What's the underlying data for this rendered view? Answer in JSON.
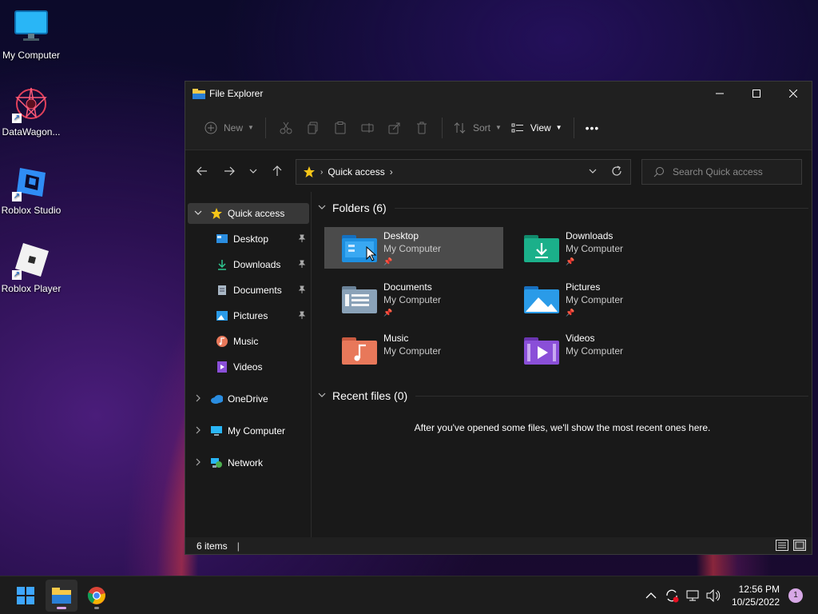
{
  "desktop": {
    "icons": [
      {
        "label": "My Computer",
        "icon": "monitor-icon"
      },
      {
        "label": "DataWagon...",
        "icon": "datawagon-icon"
      },
      {
        "label": "Roblox Studio",
        "icon": "roblox-studio-icon"
      },
      {
        "label": "Roblox Player",
        "icon": "roblox-player-icon"
      }
    ]
  },
  "window": {
    "title": "File Explorer",
    "controls": {
      "minimize": "—",
      "maximize": "☐",
      "close": "✕"
    }
  },
  "toolbar": {
    "new_label": "New",
    "sort_label": "Sort",
    "view_label": "View",
    "more_label": "•••"
  },
  "navigation": {
    "address": {
      "root_icon": "star-icon",
      "crumb": "Quick access"
    },
    "search": {
      "placeholder": "Search Quick access"
    }
  },
  "sidebar": {
    "quick_access_label": "Quick access",
    "quick_items": [
      {
        "label": "Desktop",
        "icon": "desktop-folder-icon",
        "pinned": true
      },
      {
        "label": "Downloads",
        "icon": "download-icon",
        "pinned": true
      },
      {
        "label": "Documents",
        "icon": "documents-icon",
        "pinned": true
      },
      {
        "label": "Pictures",
        "icon": "pictures-icon",
        "pinned": true
      },
      {
        "label": "Music",
        "icon": "music-icon",
        "pinned": false
      },
      {
        "label": "Videos",
        "icon": "videos-icon",
        "pinned": false
      }
    ],
    "roots": [
      {
        "label": "OneDrive",
        "icon": "cloud-icon"
      },
      {
        "label": "My Computer",
        "icon": "monitor-icon"
      },
      {
        "label": "Network",
        "icon": "network-icon"
      }
    ]
  },
  "content": {
    "folders_header": "Folders (6)",
    "folders": [
      {
        "name": "Desktop",
        "location": "My Computer",
        "pinned": true,
        "color": "#1e8fe0",
        "icon": "desktop-folder-icon",
        "selected": true
      },
      {
        "name": "Downloads",
        "location": "My Computer",
        "pinned": true,
        "color": "#1bb08a",
        "icon": "download-icon",
        "selected": false
      },
      {
        "name": "Documents",
        "location": "My Computer",
        "pinned": true,
        "color": "#8aa2b8",
        "icon": "documents-icon",
        "selected": false
      },
      {
        "name": "Pictures",
        "location": "My Computer",
        "pinned": true,
        "color": "#2a9be8",
        "icon": "pictures-icon",
        "selected": false
      },
      {
        "name": "Music",
        "location": "My Computer",
        "pinned": false,
        "color": "#e8785a",
        "icon": "music-icon",
        "selected": false
      },
      {
        "name": "Videos",
        "location": "My Computer",
        "pinned": false,
        "color": "#8a4fd8",
        "icon": "videos-icon",
        "selected": false
      }
    ],
    "recent_header": "Recent files (0)",
    "recent_empty_message": "After you've opened some files, we'll show the most recent ones here."
  },
  "status": {
    "item_count": "6 items",
    "separator": "|"
  },
  "taskbar": {
    "clock_time": "12:56 PM",
    "clock_date": "10/25/2022",
    "notification_count": "1"
  },
  "colors": {
    "window_bg": "#202020",
    "selected_tile": "#4b4b4b",
    "accent_star": "#f5c518"
  }
}
